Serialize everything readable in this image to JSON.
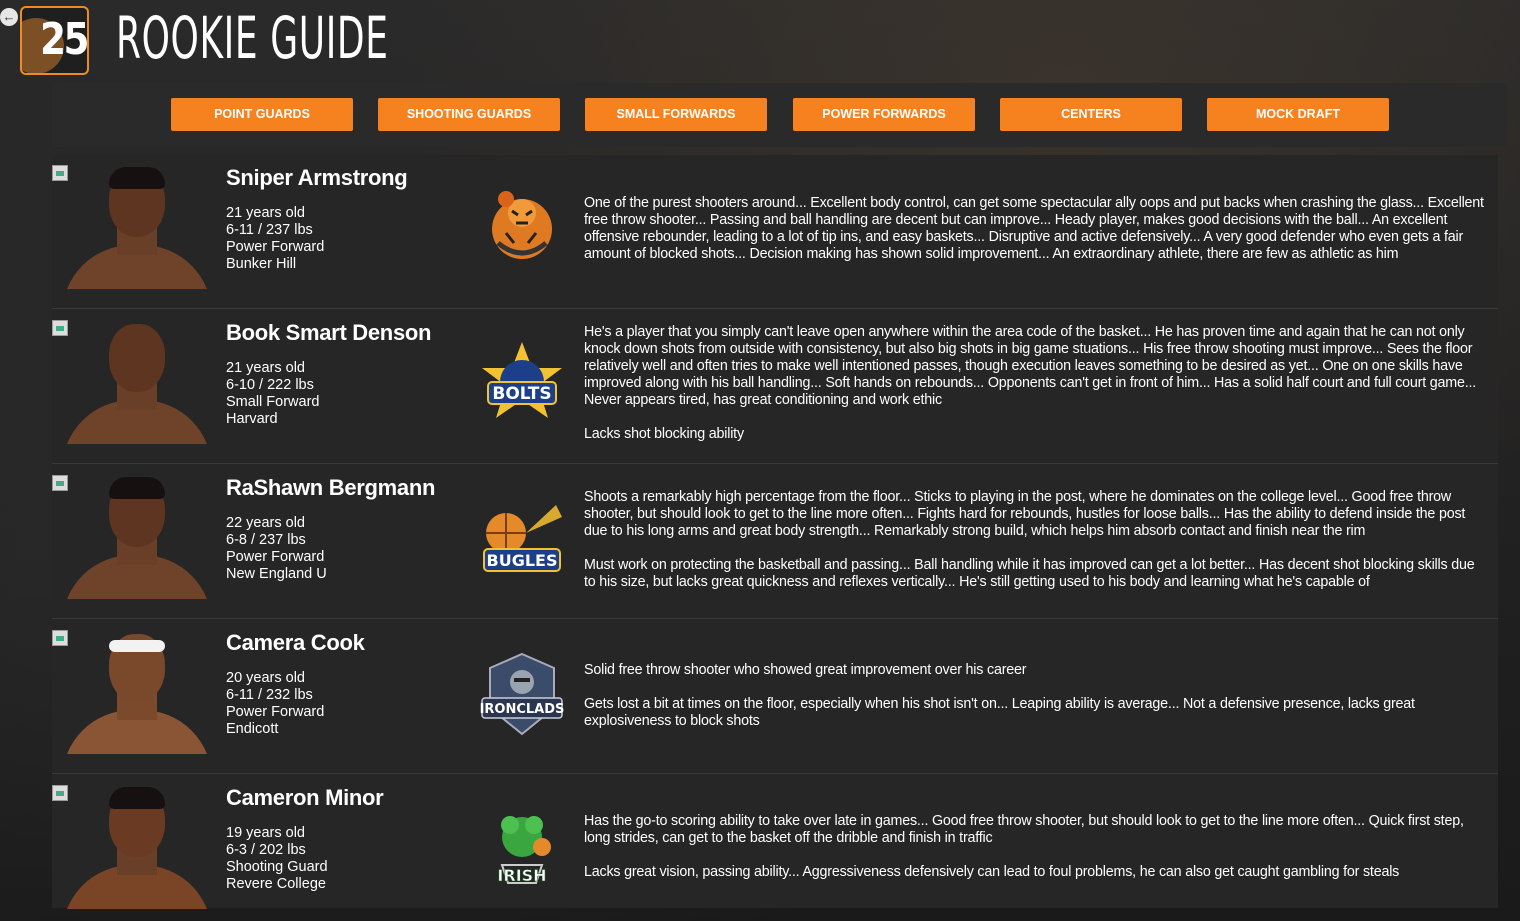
{
  "header": {
    "logo_number": "25",
    "title": "ROOKIE GUIDE"
  },
  "nav": {
    "buttons": [
      "POINT GUARDS",
      "SHOOTING GUARDS",
      "SMALL FORWARDS",
      "POWER FORWARDS",
      "CENTERS",
      "MOCK DRAFT"
    ]
  },
  "players": [
    {
      "name": "Sniper Armstrong",
      "age": "21 years old",
      "size": "6-11 / 237 lbs",
      "position": "Power Forward",
      "college": "Bunker Hill",
      "team_logo": "tiger-mascot-icon",
      "paragraphs": [
        "One of the purest shooters around... Excellent body control, can get some spectacular ally oops and put backs when crashing the glass... Excellent free throw shooter... Passing and ball handling are decent but can improve... Heady player, makes good decisions with the ball... An excellent offensive rebounder, leading to a lot of tip ins, and easy baskets... Disruptive and active defensively... A very good defender who even gets a fair amount of blocked shots... Decision making has shown solid improvement... An extraordinary athlete, there are few as athletic as him"
      ]
    },
    {
      "name": "Book Smart Denson",
      "age": "21 years old",
      "size": "6-10 / 222 lbs",
      "position": "Small Forward",
      "college": "Harvard",
      "team_logo": "bolts-logo-icon",
      "paragraphs": [
        "He's a player that you simply can't leave open anywhere within the area code of the basket... He has proven time and again that he can not only knock down shots from outside with consistency, but also big shots in big game stuations... His free throw shooting must improve... Sees the floor relatively well and often tries to make well intentioned passes, though execution leaves something to be desired as yet... One on one skills have improved along with his ball handling... Soft hands on rebounds... Opponents can't get in front of him... Has a solid half court and full court game... Never appears tired, has great conditioning and work ethic",
        "Lacks shot blocking ability"
      ]
    },
    {
      "name": "RaShawn Bergmann",
      "age": "22 years old",
      "size": "6-8 / 237 lbs",
      "position": "Power Forward",
      "college": "New England U",
      "team_logo": "bugles-logo-icon",
      "paragraphs": [
        "Shoots a remarkably high percentage from the floor... Sticks to playing in the post, where he dominates on the college level... Good free throw shooter, but should look to get to the line more often... Fights hard for rebounds, hustles for loose balls... Has the ability to defend inside the post due to his long arms and great body strength... Remarkably strong build, which helps him absorb contact and finish near the rim",
        "Must work on protecting the basketball and passing... Ball handling while it has improved can get a lot better... Has decent shot blocking skills due to his size, but lacks great quickness and reflexes vertically... He's still getting used to his body and learning what he's capable of"
      ]
    },
    {
      "name": "Camera Cook",
      "age": "20 years old",
      "size": "6-11 / 232 lbs",
      "position": "Power Forward",
      "college": "Endicott",
      "team_logo": "ironclads-logo-icon",
      "paragraphs": [
        "Solid free throw shooter who showed great improvement over his career",
        "Gets lost a bit at times on the floor, especially when his shot isn't on... Leaping ability is average... Not a defensive presence, lacks great explosiveness to block shots"
      ]
    },
    {
      "name": "Cameron Minor",
      "age": "19 years old",
      "size": "6-3 / 202 lbs",
      "position": "Shooting Guard",
      "college": "Revere College",
      "team_logo": "irish-logo-icon",
      "paragraphs": [
        "Has the go-to scoring ability to take over late in games... Good free throw shooter, but should look to get to the line more often... Quick first step, long strides, can get to the basket off the dribble and finish in traffic",
        "Lacks great vision, passing ability... Aggressiveness defensively can lead to foul problems, he can also get caught gambling for steals"
      ]
    }
  ]
}
